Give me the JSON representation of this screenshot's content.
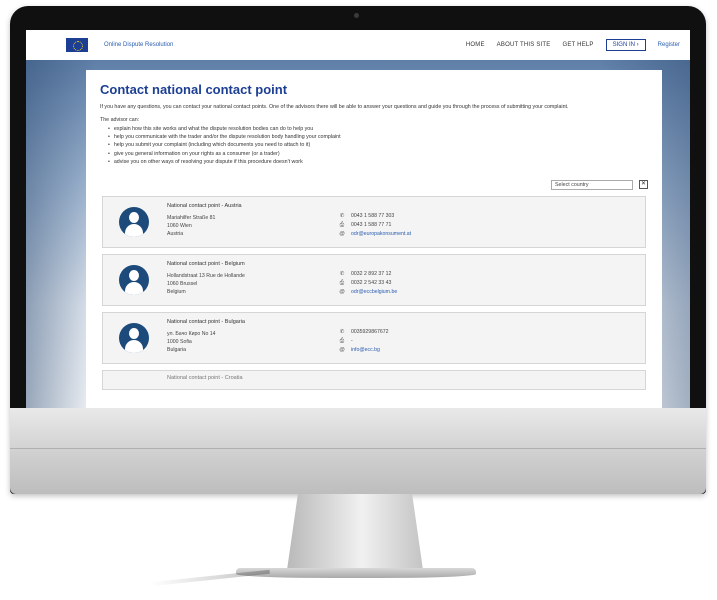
{
  "header": {
    "site_title": "Online Dispute Resolution",
    "nav": [
      "HOME",
      "ABOUT THIS SITE",
      "GET HELP"
    ],
    "sign_in": "SIGN IN ›",
    "register": "Register"
  },
  "page": {
    "title": "Contact national contact point",
    "intro": "If you have any questions, you can contact your national contact points. One of the advisors there will be able to answer your questions and guide you through the process of submitting your complaint.",
    "advisor_title": "The advisor can:",
    "advisor_items": [
      "explain how this site works and what the dispute resolution bodies can do to help you",
      "help you communicate with the trader and/or the dispute resolution body handling your complaint",
      "help you submit your complaint (including which documents you need to attach to it)",
      "give you general information on your rights as a consumer (or a trader)",
      "advise you on other ways of resolving your dispute if this procedure doesn't work"
    ]
  },
  "filter": {
    "placeholder": "Select country",
    "close_label": "✕"
  },
  "contacts": [
    {
      "name": "National contact point - Austria",
      "address": [
        "Mariahilfer Straße 81",
        "1060 Wien",
        "Austria"
      ],
      "phone": "0043 1 588 77 303",
      "fax": "0043 1 588 77 71",
      "email": "odr@europakonsument.at"
    },
    {
      "name": "National contact point - Belgium",
      "address": [
        "Hollandstraat 13 Rue de Hollande",
        "1060 Brussel",
        "Belgium"
      ],
      "phone": "0032 2 892 37 12",
      "fax": "0032 2 542 33 43",
      "email": "odr@eccbelgium.be"
    },
    {
      "name": "National contact point - Bulgaria",
      "address": [
        "ул. Бачо Киро No 14",
        "1000 Sofia",
        "Bulgaria"
      ],
      "phone": "0035929867672",
      "fax": "-",
      "email": "info@ecc.bg"
    }
  ],
  "partial_contact": {
    "name": "National contact point - Croatia"
  },
  "icons": {
    "phone": "phone-icon",
    "fax": "fax-icon",
    "email": "email-icon",
    "avatar": "user-icon"
  },
  "colors": {
    "brand_blue": "#1c3f94",
    "link_blue": "#2a5db0",
    "avatar_blue": "#1c4a7a"
  }
}
